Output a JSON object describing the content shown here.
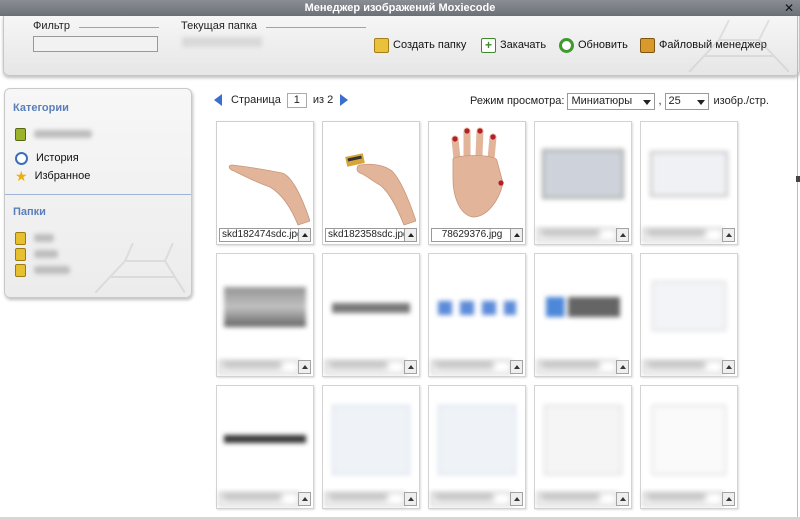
{
  "window": {
    "title": "Менеджер изображений Moxiecode",
    "close_glyph": "✕"
  },
  "toolbar": {
    "filter_label": "Фильтр",
    "filter_value": "",
    "current_folder_label": "Текущая папка",
    "create_folder": "Создать папку",
    "upload": "Закачать",
    "refresh": "Обновить",
    "file_manager": "Файловый менеджер"
  },
  "sidebar": {
    "categories_heading": "Категории",
    "history": "История",
    "favorites": "Избранное",
    "folders_heading": "Папки"
  },
  "pager": {
    "label": "Страница",
    "current": "1",
    "of_label": "из",
    "total": "2"
  },
  "view": {
    "mode_label": "Режим просмотра:",
    "mode_value": "Миниатюры",
    "per_page_value": "25",
    "per_page_suffix": "изобр./стр."
  },
  "thumbnails": [
    {
      "name": "skd182474sdc.jpg",
      "kind": "hand-open"
    },
    {
      "name": "skd182358sdc.jpg",
      "kind": "hand-card"
    },
    {
      "name": "78629376.jpg",
      "kind": "hand-nails"
    }
  ],
  "colors": {
    "accent": "#5a7fb8",
    "arrow": "#3b6fcf",
    "nails": "#b3202a"
  }
}
